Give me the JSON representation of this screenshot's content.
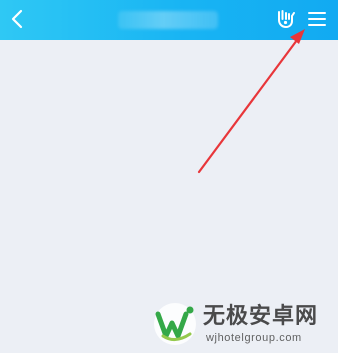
{
  "header": {
    "title_redacted": "",
    "back_icon": "chevron-left-icon",
    "gesture_icon": "hand-gesture-icon",
    "menu_icon": "hamburger-menu-icon",
    "colors": {
      "header_start": "#2fc8f4",
      "header_end": "#12aaf2",
      "icon": "#ffffff"
    }
  },
  "content": {
    "background": "#eceff5"
  },
  "annotation": {
    "arrow_color": "#e8363a"
  },
  "watermark": {
    "title": "无极安卓网",
    "url": "wjhotelgroup.com"
  }
}
